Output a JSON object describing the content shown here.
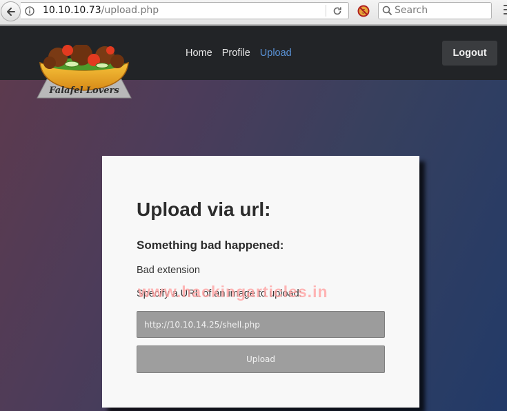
{
  "browser": {
    "url_host": "10.10.10.73",
    "url_path": "/upload.php",
    "search_placeholder": "Search"
  },
  "site": {
    "logo_text": "Falafel Lovers",
    "nav": [
      {
        "label": "Home",
        "active": false
      },
      {
        "label": "Profile",
        "active": false
      },
      {
        "label": "Upload",
        "active": true
      }
    ],
    "logout_label": "Logout"
  },
  "card": {
    "title": "Upload via url:",
    "error_title": "Something bad happened:",
    "error_message": "Bad extension",
    "prompt": "Specify a URL of an image to upload:",
    "url_value": "http://10.10.14.25/shell.php",
    "upload_label": "Upload"
  },
  "watermark": "www.hackingarticles.in",
  "colors": {
    "header_bg": "#222427",
    "nav_active": "#5a93d8",
    "card_bg": "#f8f8f8"
  }
}
